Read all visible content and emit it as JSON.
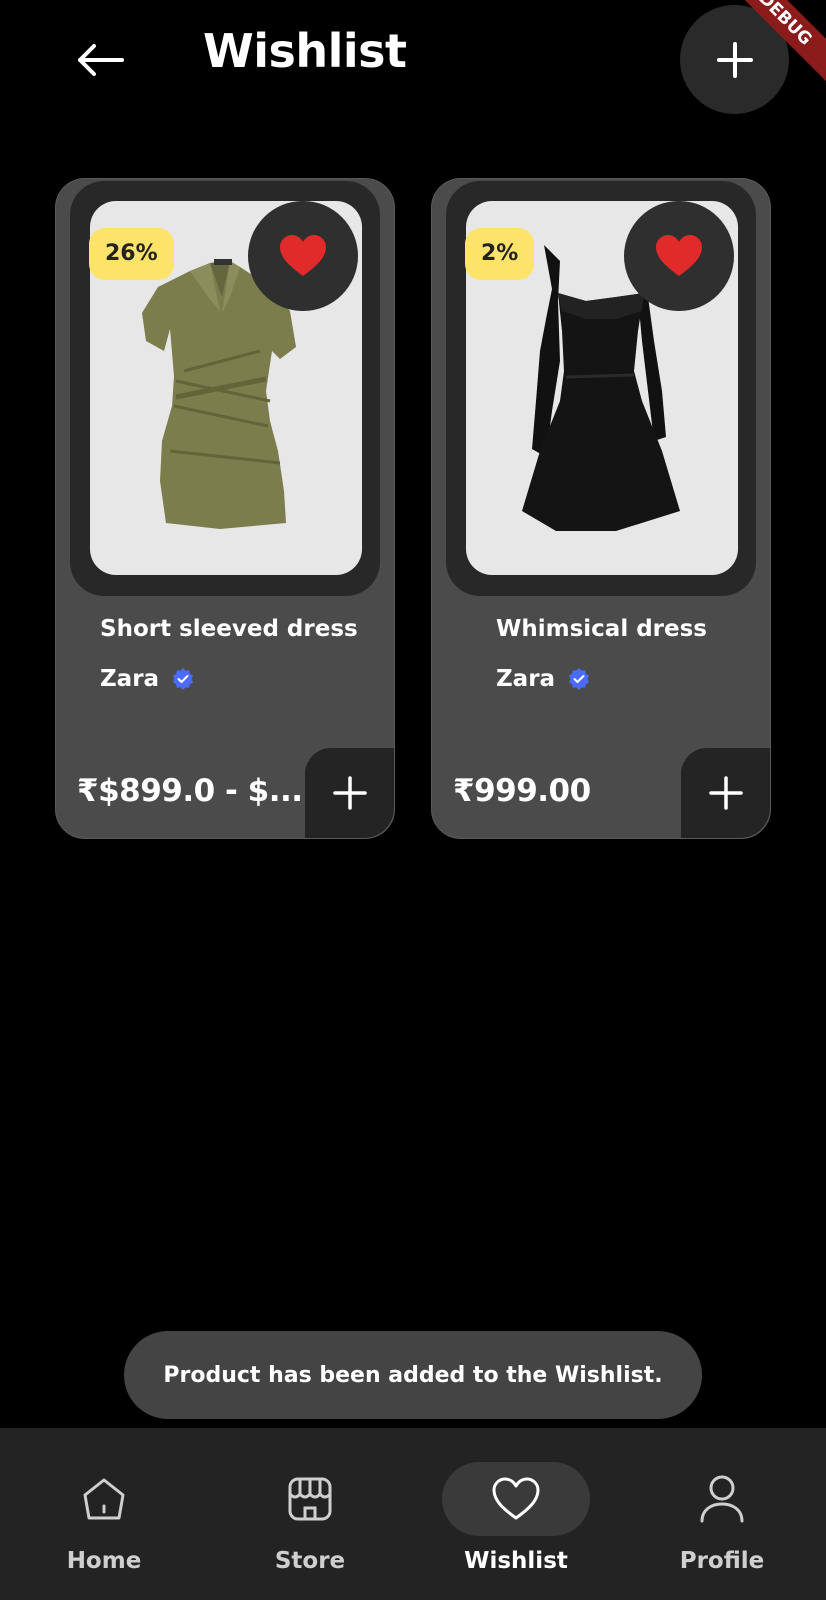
{
  "header": {
    "title": "Wishlist",
    "back_icon": "arrow-left-icon",
    "add_icon": "plus-icon",
    "debug_banner": "DEBUG"
  },
  "products": [
    {
      "discount": "26%",
      "title": "Short sleeved dress",
      "brand": "Zara",
      "price": "₹$899.0 - $...",
      "image": "olive-green-wrap-dress",
      "favorite": true
    },
    {
      "discount": "2%",
      "title": "Whimsical dress",
      "brand": "Zara",
      "price": "₹999.00",
      "image": "black-ruffle-dress",
      "favorite": true
    }
  ],
  "toast": {
    "message": "Product has been added to the Wishlist."
  },
  "nav": {
    "items": [
      {
        "label": "Home",
        "icon": "home-icon"
      },
      {
        "label": "Store",
        "icon": "store-icon"
      },
      {
        "label": "Wishlist",
        "icon": "heart-icon",
        "active": true
      },
      {
        "label": "Profile",
        "icon": "user-icon"
      }
    ]
  },
  "colors": {
    "background": "#000000",
    "card": "#4b4b4b",
    "discount_badge": "#fde36a",
    "heart": "#e12a2a",
    "verified": "#4b6bff",
    "nav_bar": "#232323"
  }
}
